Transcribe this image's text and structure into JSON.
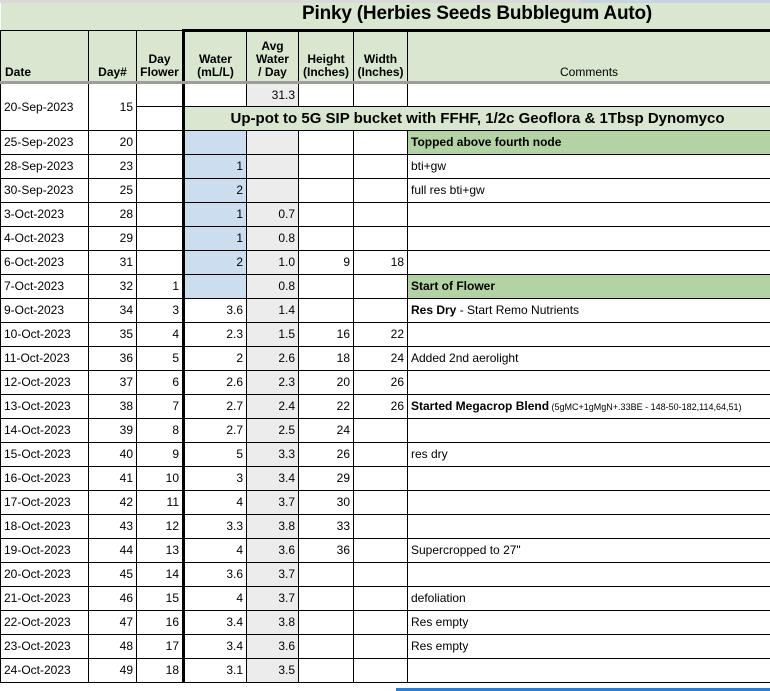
{
  "title": "Pinky (Herbies Seeds Bubblegum Auto)",
  "columns": {
    "date": "Date",
    "day_num": "Day#",
    "day_flower_l1": "Day",
    "day_flower_l2": "Flower",
    "water_l1": "Water",
    "water_l2": "(mL/L)",
    "avg_l1": "Avg",
    "avg_l2": "Water",
    "avg_l3": "/ Day",
    "height_l1": "Height",
    "height_l2": "(Inches)",
    "width_l1": "Width",
    "width_l2": "(Inches)",
    "comments": "Comments"
  },
  "colors": {
    "header_green": "#d9e7d0",
    "note_green": "#b4d3a4",
    "water_blue": "#ccddef",
    "avg_gray": "#ececec",
    "selection_blue": "#2a7fd4"
  },
  "first_row": {
    "date": "20-Sep-2023",
    "day_num": "15",
    "day_flower": "",
    "water": "",
    "avg_water": "31.3",
    "height": "",
    "width": "",
    "banner": "Up-pot to 5G SIP bucket with FFHF, 1/2c Geoflora & 1Tbsp Dynomyco"
  },
  "rows": [
    {
      "date": "25-Sep-2023",
      "day_num": "20",
      "day_flower": "",
      "water": "",
      "avg_water": "",
      "height": "",
      "width": "",
      "comment": "Topped above fourth node",
      "comment_bold": true,
      "comment_fill": "note-green",
      "water_fill": "fill-blue",
      "avg_fill": "fill-gray"
    },
    {
      "date": "28-Sep-2023",
      "day_num": "23",
      "day_flower": "",
      "water": "1",
      "avg_water": "",
      "height": "",
      "width": "",
      "comment": "bti+gw",
      "comment_bold": false,
      "comment_fill": "",
      "water_fill": "fill-blue",
      "avg_fill": "fill-gray"
    },
    {
      "date": "30-Sep-2023",
      "day_num": "25",
      "day_flower": "",
      "water": "2",
      "avg_water": "",
      "height": "",
      "width": "",
      "comment": "full res bti+gw",
      "comment_bold": false,
      "comment_fill": "",
      "water_fill": "fill-blue",
      "avg_fill": "fill-gray"
    },
    {
      "date": "3-Oct-2023",
      "day_num": "28",
      "day_flower": "",
      "water": "1",
      "avg_water": "0.7",
      "height": "",
      "width": "",
      "comment": "",
      "comment_bold": false,
      "comment_fill": "",
      "water_fill": "fill-blue",
      "avg_fill": "fill-gray"
    },
    {
      "date": "4-Oct-2023",
      "day_num": "29",
      "day_flower": "",
      "water": "1",
      "avg_water": "0.8",
      "height": "",
      "width": "",
      "comment": "",
      "comment_bold": false,
      "comment_fill": "",
      "water_fill": "fill-blue",
      "avg_fill": "fill-gray"
    },
    {
      "date": "6-Oct-2023",
      "day_num": "31",
      "day_flower": "",
      "water": "2",
      "avg_water": "1.0",
      "height": "9",
      "width": "18",
      "comment": "",
      "comment_bold": false,
      "comment_fill": "",
      "water_fill": "fill-blue",
      "avg_fill": "fill-gray"
    },
    {
      "date": "7-Oct-2023",
      "day_num": "32",
      "day_flower": "1",
      "water": "",
      "avg_water": "0.8",
      "height": "",
      "width": "",
      "comment": "Start of Flower",
      "comment_bold": true,
      "comment_fill": "note-green",
      "water_fill": "fill-blue",
      "avg_fill": "fill-gray"
    },
    {
      "date": "9-Oct-2023",
      "day_num": "34",
      "day_flower": "3",
      "water": "3.6",
      "avg_water": "1.4",
      "height": "",
      "width": "",
      "comment_lead": "Res Dry",
      "comment_rest": " - Start Remo Nutrients",
      "comment_bold": false,
      "comment_fill": "",
      "water_fill": "",
      "avg_fill": "fill-gray"
    },
    {
      "date": "10-Oct-2023",
      "day_num": "35",
      "day_flower": "4",
      "water": "2.3",
      "avg_water": "1.5",
      "height": "16",
      "width": "22",
      "comment": "",
      "comment_bold": false,
      "comment_fill": "",
      "water_fill": "",
      "avg_fill": "fill-gray"
    },
    {
      "date": "11-Oct-2023",
      "day_num": "36",
      "day_flower": "5",
      "water": "2",
      "avg_water": "2.6",
      "height": "18",
      "width": "24",
      "comment": "Added 2nd aerolight",
      "comment_bold": false,
      "comment_fill": "",
      "water_fill": "",
      "avg_fill": "fill-gray"
    },
    {
      "date": "12-Oct-2023",
      "day_num": "37",
      "day_flower": "6",
      "water": "2.6",
      "avg_water": "2.3",
      "height": "20",
      "width": "26",
      "comment": "",
      "comment_bold": false,
      "comment_fill": "",
      "water_fill": "",
      "avg_fill": "fill-gray"
    },
    {
      "date": "13-Oct-2023",
      "day_num": "38",
      "day_flower": "7",
      "water": "2.7",
      "avg_water": "2.4",
      "height": "22",
      "width": "26",
      "comment_lead": "Started Megacrop Blend",
      "comment_tiny": " (5gMC+1gMgN+.33BE - 148-50-182,114,64,51)",
      "comment_bold": false,
      "comment_fill": "",
      "water_fill": "",
      "avg_fill": "fill-gray"
    },
    {
      "date": "14-Oct-2023",
      "day_num": "39",
      "day_flower": "8",
      "water": "2.7",
      "avg_water": "2.5",
      "height": "24",
      "width": "",
      "comment": "",
      "comment_bold": false,
      "comment_fill": "",
      "water_fill": "",
      "avg_fill": "fill-gray"
    },
    {
      "date": "15-Oct-2023",
      "day_num": "40",
      "day_flower": "9",
      "water": "5",
      "avg_water": "3.3",
      "height": "26",
      "width": "",
      "comment": "res dry",
      "comment_bold": false,
      "comment_fill": "",
      "water_fill": "",
      "avg_fill": "fill-gray"
    },
    {
      "date": "16-Oct-2023",
      "day_num": "41",
      "day_flower": "10",
      "water": "3",
      "avg_water": "3.4",
      "height": "29",
      "width": "",
      "comment": "",
      "comment_bold": false,
      "comment_fill": "",
      "water_fill": "",
      "avg_fill": "fill-gray"
    },
    {
      "date": "17-Oct-2023",
      "day_num": "42",
      "day_flower": "11",
      "water": "4",
      "avg_water": "3.7",
      "height": "30",
      "width": "",
      "comment": "",
      "comment_bold": false,
      "comment_fill": "",
      "water_fill": "",
      "avg_fill": "fill-gray"
    },
    {
      "date": "18-Oct-2023",
      "day_num": "43",
      "day_flower": "12",
      "water": "3.3",
      "avg_water": "3.8",
      "height": "33",
      "width": "",
      "comment": "",
      "comment_bold": false,
      "comment_fill": "",
      "water_fill": "",
      "avg_fill": "fill-gray"
    },
    {
      "date": "19-Oct-2023",
      "day_num": "44",
      "day_flower": "13",
      "water": "4",
      "avg_water": "3.6",
      "height": "36",
      "width": "",
      "comment": "Supercropped to 27\"",
      "comment_bold": false,
      "comment_fill": "",
      "water_fill": "",
      "avg_fill": "fill-gray"
    },
    {
      "date": "20-Oct-2023",
      "day_num": "45",
      "day_flower": "14",
      "water": "3.6",
      "avg_water": "3.7",
      "height": "",
      "width": "",
      "comment": "",
      "comment_bold": false,
      "comment_fill": "",
      "water_fill": "",
      "avg_fill": "fill-gray"
    },
    {
      "date": "21-Oct-2023",
      "day_num": "46",
      "day_flower": "15",
      "water": "4",
      "avg_water": "3.7",
      "height": "",
      "width": "",
      "comment": "defoliation",
      "comment_bold": false,
      "comment_fill": "",
      "water_fill": "",
      "avg_fill": "fill-gray"
    },
    {
      "date": "22-Oct-2023",
      "day_num": "47",
      "day_flower": "16",
      "water": "3.4",
      "avg_water": "3.8",
      "height": "",
      "width": "",
      "comment": "Res empty",
      "comment_bold": false,
      "comment_fill": "",
      "water_fill": "",
      "avg_fill": "fill-gray"
    },
    {
      "date": "23-Oct-2023",
      "day_num": "48",
      "day_flower": "17",
      "water": "3.4",
      "avg_water": "3.6",
      "height": "",
      "width": "",
      "comment": "Res empty",
      "comment_bold": false,
      "comment_fill": "",
      "water_fill": "",
      "avg_fill": "fill-gray"
    },
    {
      "date": "24-Oct-2023",
      "day_num": "49",
      "day_flower": "18",
      "water": "3.1",
      "avg_water": "3.5",
      "height": "",
      "width": "",
      "comment": "",
      "comment_bold": false,
      "comment_fill": "",
      "water_fill": "",
      "avg_fill": "fill-gray"
    }
  ]
}
